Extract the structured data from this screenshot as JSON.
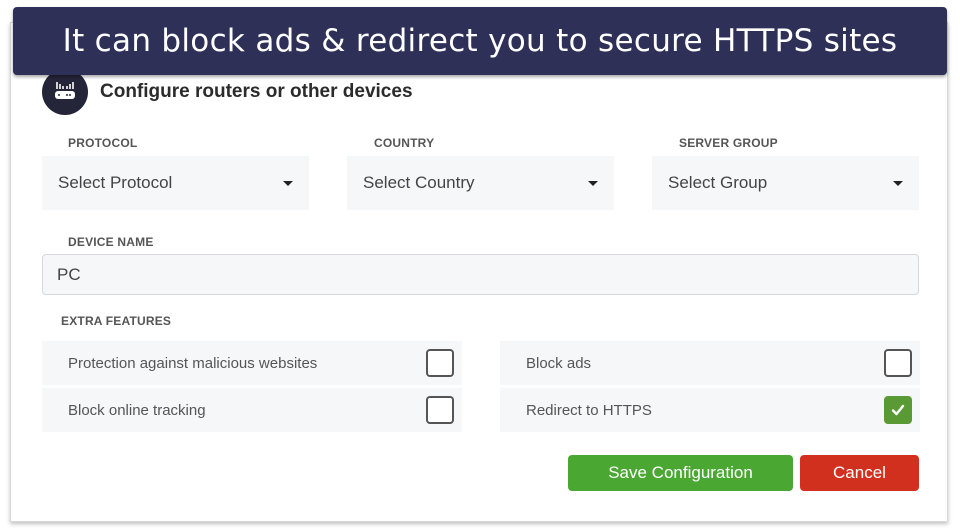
{
  "banner": {
    "caption": "It can block ads & redirect you to secure HTTPS sites"
  },
  "header": {
    "icon": "router-icon",
    "title": "Configure routers or other devices"
  },
  "selects": {
    "protocol": {
      "label": "PROTOCOL",
      "value": "Select Protocol"
    },
    "country": {
      "label": "COUNTRY",
      "value": "Select Country"
    },
    "server_group": {
      "label": "SERVER GROUP",
      "value": "Select Group"
    }
  },
  "device_name": {
    "label": "DEVICE NAME",
    "value": "PC"
  },
  "extra_features": {
    "label": "EXTRA FEATURES",
    "items": [
      {
        "label": "Protection against malicious websites",
        "checked": false
      },
      {
        "label": "Block ads",
        "checked": false
      },
      {
        "label": "Block online tracking",
        "checked": false
      },
      {
        "label": "Redirect to HTTPS",
        "checked": true
      }
    ]
  },
  "actions": {
    "save_label": "Save Configuration",
    "cancel_label": "Cancel"
  },
  "colors": {
    "banner_bg": "#2f3057",
    "save_button": "#4aa832",
    "cancel_button": "#d2301f",
    "checkbox_checked": "#5a9a35"
  }
}
